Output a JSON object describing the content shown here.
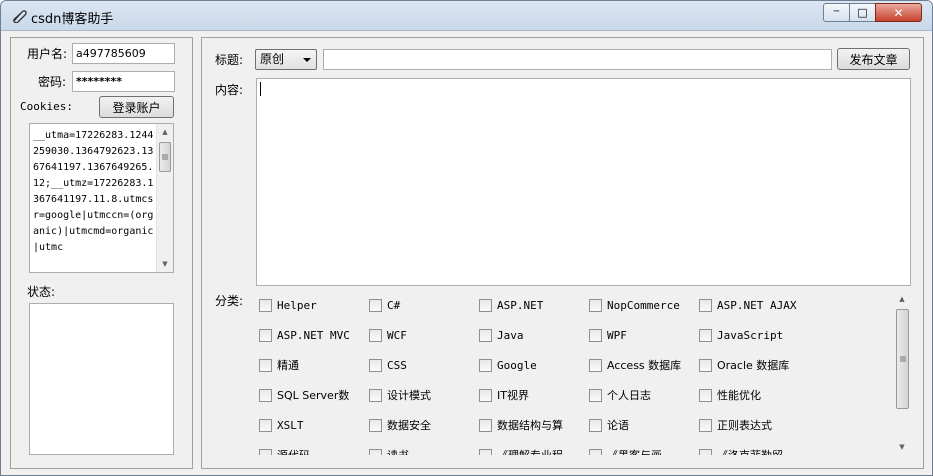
{
  "window": {
    "title": "csdn博客助手",
    "minimize_glyph": "─",
    "maximize_glyph": "□",
    "close_glyph": "✕"
  },
  "login": {
    "username_label": "用户名:",
    "username_value": "a497785609",
    "password_label": "密码:",
    "password_value": "********",
    "cookies_label": "Cookies:",
    "login_button": "登录账户",
    "cookies_text": "__utma=17226283.1244259030.1364792623.1367641197.1367649265.12;__utmz=17226283.1367641197.11.8.utmcsr=google|utmccn=(organic)|utmcmd=organic|utmc"
  },
  "status": {
    "label": "状态:"
  },
  "editor": {
    "title_label": "标题:",
    "type_selected": "原创",
    "title_value": "",
    "publish_button": "发布文章",
    "content_label": "内容:",
    "category_label": "分类:"
  },
  "categories": [
    "Helper",
    "C#",
    "ASP.NET",
    "NopCommerce",
    "ASP.NET AJAX",
    "ASP.NET MVC",
    "WCF",
    "Java",
    "WPF",
    "JavaScript",
    "精通",
    "CSS",
    "Google",
    "Access 数据库",
    "Oracle 数据库",
    "SQL Server数",
    "设计模式",
    "IT视界",
    "个人日志",
    "性能优化",
    "XSLT",
    "数据安全",
    "数据结构与算",
    "论语",
    "正则表达式",
    "源代码",
    "读书",
    "《理解专业程",
    "《黑客与画",
    "《洛克菲勒留"
  ],
  "colors": {
    "window_bg": "#f0f0f0",
    "titlebar": "#c9d8ea",
    "close_button": "#c8432c"
  }
}
